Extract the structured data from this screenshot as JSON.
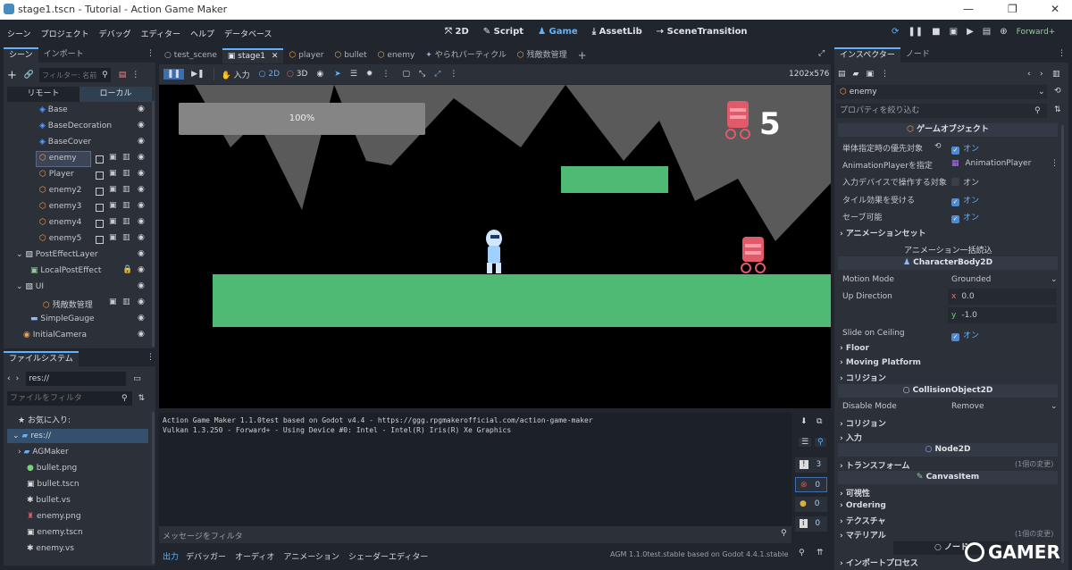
{
  "window": {
    "title": "stage1.tscn - Tutorial - Action Game Maker",
    "controls": [
      "—",
      "❐",
      "✕"
    ]
  },
  "menu": [
    "シーン",
    "プロジェクト",
    "デバッグ",
    "エディター",
    "ヘルプ",
    "データベース"
  ],
  "workspaces": [
    "2D",
    "Script",
    "Game",
    "AssetLib",
    "SceneTransition"
  ],
  "active_workspace": "Game",
  "renderer": "Forward+",
  "scene_dock": {
    "tabs": [
      "シーン",
      "インポート"
    ],
    "filter_placeholder": "フィルター: 名前",
    "remote": "リモート",
    "local": "ローカル",
    "nodes": [
      {
        "name": "Base"
      },
      {
        "name": "BaseDecoration"
      },
      {
        "name": "BaseCover"
      },
      {
        "name": "enemy"
      },
      {
        "name": "Player"
      },
      {
        "name": "enemy2"
      },
      {
        "name": "enemy3"
      },
      {
        "name": "enemy4"
      },
      {
        "name": "enemy5"
      },
      {
        "name": "PostEffectLayer"
      },
      {
        "name": "LocalPostEffect"
      },
      {
        "name": "UI"
      },
      {
        "name": "残敵数管理"
      },
      {
        "name": "SimpleGauge"
      },
      {
        "name": "InitialCamera"
      }
    ]
  },
  "filesystem": {
    "tab": "ファイルシステム",
    "path": "res://",
    "filter_placeholder": "ファイルをフィルタ",
    "favorites": "お気に入り:",
    "root": "res://",
    "files": [
      "AGMaker",
      "bullet.png",
      "bullet.tscn",
      "bullet.vs",
      "enemy.png",
      "enemy.tscn",
      "enemy.vs"
    ]
  },
  "editor_tabs": [
    "test_scene",
    "stage1",
    "player",
    "bullet",
    "enemy",
    "やられパーティクル",
    "残敵数管理"
  ],
  "game_toolbar": {
    "input": "入力",
    "mode2d": "2D",
    "mode3d": "3D",
    "resolution": "1202x576"
  },
  "game": {
    "gauge_label": "100%",
    "gauge_level": 1.0,
    "enemy_count": "5"
  },
  "output": {
    "lines": [
      "Action Game Maker 1.1.0test based on Godot v4.4 - https://ggg.rpgmakerofficial.com/action-game-maker",
      "Vulkan 1.3.250 - Forward+ - Using Device #0: Intel - Intel(R) Iris(R) Xe Graphics"
    ],
    "filter_placeholder": "メッセージをフィルタ",
    "counts": [
      "3",
      "0",
      "0",
      "0"
    ]
  },
  "bottom_tabs": [
    "出力",
    "デバッガー",
    "オーディオ",
    "アニメーション",
    "シェーダーエディター"
  ],
  "version": "AGM 1.1.0test.stable based on Godot 4.4.1.stable",
  "inspector": {
    "tabs": [
      "インスペクター",
      "ノード"
    ],
    "node": "enemy",
    "filter_placeholder": "プロパティを絞り込む",
    "sec_gameobject": "ゲームオブジェクト",
    "rows": [
      {
        "k": "単体指定時の優先対象",
        "v": "オン"
      },
      {
        "k": "AnimationPlayerを指定",
        "v": "AnimationPlayer"
      },
      {
        "k": "入力デバイスで操作する対象",
        "v": "オン"
      },
      {
        "k": "タイル効果を受ける",
        "v": "オン"
      },
      {
        "k": "セーブ可能",
        "v": "オン"
      }
    ],
    "anim_set": "アニメーションセット",
    "anim_bulk": "アニメーション一括読込",
    "sec_body": "CharacterBody2D",
    "motion_mode_k": "Motion Mode",
    "motion_mode_v": "Grounded",
    "up_dir_k": "Up Direction",
    "up_x": "0.0",
    "up_y": "-1.0",
    "slide_k": "Slide on Ceiling",
    "slide_v": "オン",
    "floor": "Floor",
    "moving": "Moving Platform",
    "collision": "コリジョン",
    "sec_collision": "CollisionObject2D",
    "disable_k": "Disable Mode",
    "disable_v": "Remove",
    "collision2": "コリジョン",
    "input": "入力",
    "sec_node2d": "Node2D",
    "transform": "トランスフォーム",
    "changed": "(1個の変更)",
    "sec_canvas": "CanvasItem",
    "visibility": "可視性",
    "ordering": "Ordering",
    "texture": "テクスチャ",
    "material": "マテリアル",
    "changed2": "(1個の変更)",
    "sec_node": "ノード",
    "import": "インポートプロセス"
  },
  "watermark": "GAMER"
}
